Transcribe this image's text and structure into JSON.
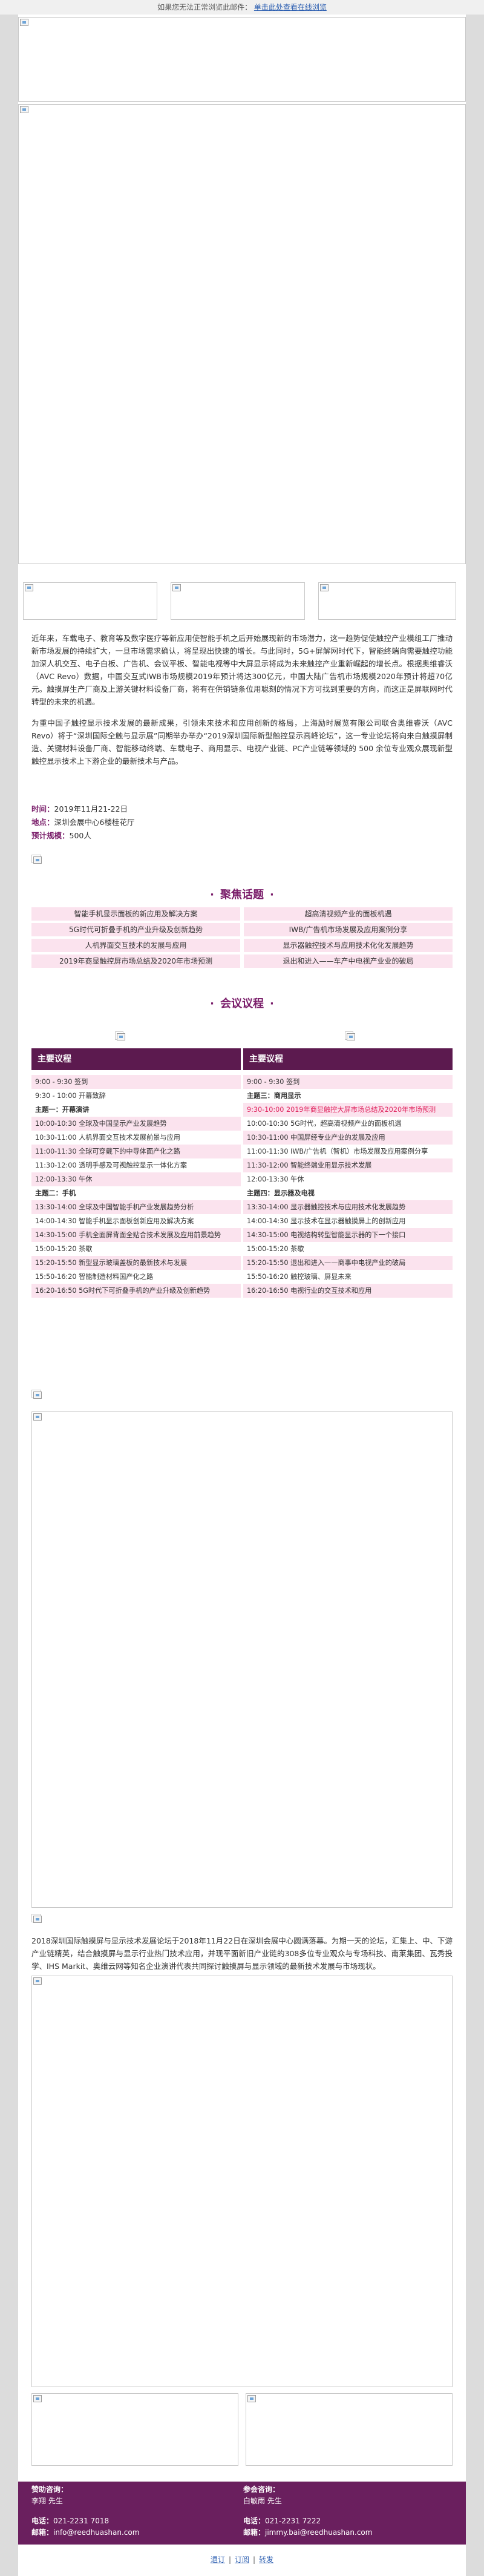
{
  "topbar": {
    "notice": "如果您无法正常浏览此邮件：",
    "link": "单击此处查看在线浏览"
  },
  "intro": {
    "p1": "近年来，车载电子、教育等及数字医疗等新应用使智能手机之后开始展现新的市场潜力，这一趋势促使触控产业模组工厂推动新市场发展的持续扩大，一旦市场需求确认，将呈现出快速的增长。与此同时，5G+屏解网时代下，智能终端向需要触控功能加深人机交互、电子白板、广告机、会议平板、智能电视等中大屏显示将成为未来触控产业重新崛起的增长点。根据奥维睿沃（AVC Revo）数据，中国交互式IWB市场规模2019年预计将达300亿元，中国大陆广告机市场规模2020年预计将超70亿元。触摸屏生产厂商及上游关键材料设备厂商，将有在供销链条位用聪刻的情况下方可找到重要的方向，而这正是屏联网时代转型的未来的机遇。",
    "p2": "为重中国子触控显示技术发展的最新成果，引领未来技术和应用创新的格局，上海励时展览有限公司联合奥维睿沃（AVC Revo）将于“深圳国际全触与显示展”同期举办举办“2019深圳国际新型触控显示高峰论坛”，这一专业论坛将向来自触摸屏制造、关键材料设备厂商、智能移动终端、车载电子、商用显示、电视产业链、PC产业链等领域的 500 余位专业观众展现新型触控显示技术上下游企业的最新技术与产品。"
  },
  "facts": {
    "time_label": "时间：",
    "time": "2019年11月21-22日",
    "venue_label": "地点：",
    "venue": "深圳会展中心6楼桂花厅",
    "size_label": "预计规模：",
    "size": "500人"
  },
  "topics": {
    "heading": "聚焦话题",
    "items": [
      "智能手机显示面板的新应用及解决方案",
      "超高清视频产业的面板机遇",
      "5G时代可折叠手机的产业升级及创新趋势",
      "IWB/广告机市场发展及应用案例分享",
      "人机界面交互技术的发展与应用",
      "显示器触控技术与应用技术化化发展趋势",
      "2019年商显触控屏市场总结及2020年市场预测",
      "退出和进入——车产中电视产业业的破局"
    ]
  },
  "agenda": {
    "heading": "会议议程",
    "left": {
      "title": "主要议程",
      "rows": [
        {
          "t": "9:00 - 9:30 签到",
          "s": "pink"
        },
        {
          "t": "9:30 - 10:00 开幕致辞",
          "s": "plain"
        },
        {
          "t": "主题一：开幕演讲",
          "s": "sub"
        },
        {
          "t": "10:00-10:30 全球及中国显示产业发展趋势",
          "s": "pink"
        },
        {
          "t": "10:30-11:00 人机界面交互技术发展前景与应用",
          "s": "plain"
        },
        {
          "t": "11:00-11:30 全球可穿戴下的中导体面产化之路",
          "s": "pink"
        },
        {
          "t": "11:30-12:00 透明手感及可视触控显示一体化方案",
          "s": "plain"
        },
        {
          "t": "12:00-13:30 午休",
          "s": "pink"
        },
        {
          "t": "主题二：手机",
          "s": "sub"
        },
        {
          "t": "13:30-14:00 全球及中国智能手机产业发展趋势分析",
          "s": "pink"
        },
        {
          "t": "14:00-14:30 智能手机显示面板创新应用及解决方案",
          "s": "plain"
        },
        {
          "t": "14:30-15:00 手机全面屏背面全贴合技术发展及应用前景趋势",
          "s": "pink"
        },
        {
          "t": "15:00-15:20 茶歇",
          "s": "plain"
        },
        {
          "t": "15:20-15:50 新型显示玻璃盖板的最新技术与发展",
          "s": "pink"
        },
        {
          "t": "15:50-16:20 智能制造材料国产化之路",
          "s": "plain"
        },
        {
          "t": "16:20-16:50 5G时代下可折叠手机的产业升级及创新趋势",
          "s": "pink"
        }
      ]
    },
    "right": {
      "title": "主要议程",
      "rows": [
        {
          "t": "9:00 - 9:30 签到",
          "s": "pink"
        },
        {
          "t": "主题三：商用显示",
          "s": "sub"
        },
        {
          "t": "9:30-10:00 2019年商显触控大屏市场总结及2020年市场预测",
          "s": "pinkred"
        },
        {
          "t": "10:00-10:30 5G时代，超高清视频产业的面板机遇",
          "s": "plain"
        },
        {
          "t": "10:30-11:00 中国屏经专业产业的发展及应用",
          "s": "pink"
        },
        {
          "t": "11:00-11:30 IWB/广告机（智机）市场发展及应用案例分享",
          "s": "plain"
        },
        {
          "t": "11:30-12:00 智能终端业用显示技术发展",
          "s": "pink"
        },
        {
          "t": "12:00-13:30 午休",
          "s": "plain"
        },
        {
          "t": "主题四：显示器及电视",
          "s": "sub"
        },
        {
          "t": "13:30-14:00 显示器触控技术与应用技术化发展趋势",
          "s": "pink"
        },
        {
          "t": "14:00-14:30 显示技术在显示器触摸屏上的创新应用",
          "s": "plain"
        },
        {
          "t": "14:30-15:00 电视结构转型智能显示器的下一个接口",
          "s": "pink"
        },
        {
          "t": "15:00-15:20 茶歇",
          "s": "plain"
        },
        {
          "t": "15:20-15:50 退出和进入——商事中电视产业的破局",
          "s": "pink"
        },
        {
          "t": "15:50-16:20 触控玻璃、屏显未来",
          "s": "plain"
        },
        {
          "t": "16:20-16:50 电视行业的交互技术和应用",
          "s": "pink"
        }
      ]
    }
  },
  "para2": "2018深圳国际触摸屏与显示技术发展论坛于2018年11月22日在深圳会展中心圆满落幕。为期一天的论坛，汇集上、中、下游产业链精英，结合触摸屏与显示行业热门技术应用，并现平面新旧产业链的308多位专业观众与专场科技、南莱集团、瓦秀投学、IHS Markit、奥维云网等知名企业演讲代表共同探讨触摸屏与显示领域的最新技术发展与市场现状。",
  "footer": {
    "left": {
      "contact_label": "赞助咨询：",
      "name": "李翔 先生",
      "phone_label": "电话：",
      "phone": "021-2231 7018",
      "email_label": "邮箱：",
      "email": "info@reedhuashan.com"
    },
    "right": {
      "contact_label": "参会咨询：",
      "name": "白敏雨 先生",
      "phone_label": "电话：",
      "phone": "021-2231 7222",
      "email_label": "邮箱：",
      "email": "jimmy.bai@reedhuashan.com"
    }
  },
  "unsubscribe": {
    "a": "退订",
    "b": "订阅",
    "c": "转发"
  }
}
